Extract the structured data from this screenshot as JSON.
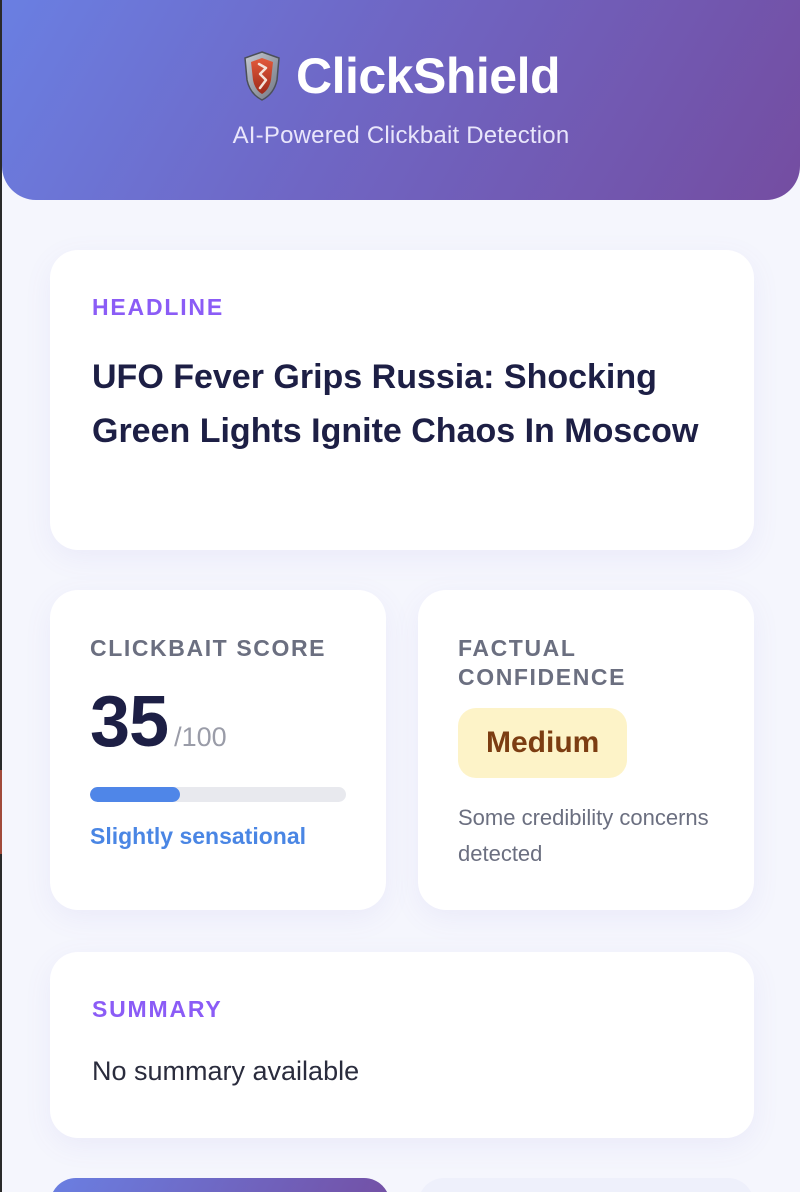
{
  "header": {
    "icon": "shield-icon",
    "title": "ClickShield",
    "tagline": "AI-Powered Clickbait Detection"
  },
  "headline": {
    "label": "HEADLINE",
    "text": "UFO Fever Grips Russia: Shocking Green Lights Ignite Chaos In Moscow"
  },
  "clickbait_score": {
    "label": "CLICKBAIT SCORE",
    "value": "35",
    "max": "/100",
    "progress_fraction": 0.35,
    "description": "Slightly sensational"
  },
  "factual_confidence": {
    "label": "FACTUAL CONFIDENCE",
    "level": "Medium",
    "description": "Some credibility concerns detected"
  },
  "summary": {
    "label": "SUMMARY",
    "text": "No summary available"
  },
  "colors": {
    "accent": "#8b5cf6",
    "progress": "#4f86e8",
    "badge_bg": "#fdf3c8",
    "badge_text": "#7c3d12",
    "header_start": "#6a7fe2",
    "header_end": "#744da1"
  }
}
